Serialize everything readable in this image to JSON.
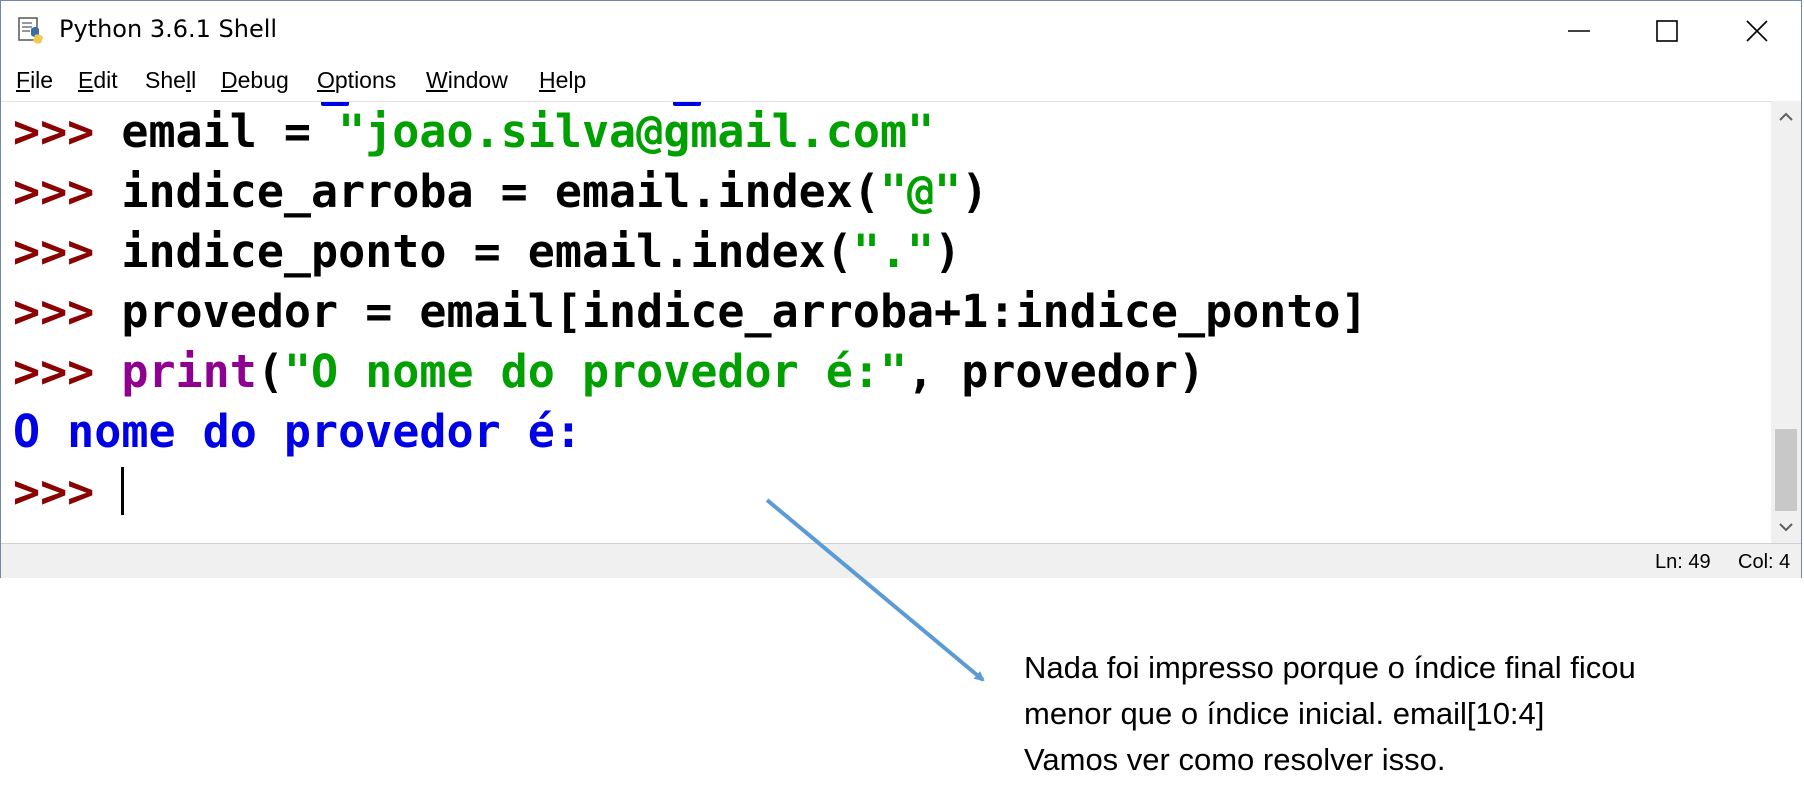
{
  "window": {
    "title": "Python 3.6.1 Shell",
    "controls": [
      "minimize",
      "maximize",
      "close"
    ]
  },
  "menu": [
    {
      "label": "File",
      "mnemonic": "F",
      "rest": "ile"
    },
    {
      "label": "Edit",
      "mnemonic": "E",
      "rest": "dit"
    },
    {
      "label": "Shell",
      "pre": "She",
      "mnemonic": "l",
      "rest": "l"
    },
    {
      "label": "Debug",
      "mnemonic": "D",
      "rest": "ebug"
    },
    {
      "label": "Options",
      "mnemonic": "O",
      "rest": "ptions"
    },
    {
      "label": "Window",
      "mnemonic": "W",
      "rest": "indow"
    },
    {
      "label": "Help",
      "mnemonic": "H",
      "rest": "elp"
    }
  ],
  "shell": {
    "prompt": ">>>",
    "lines": [
      {
        "kind": "input",
        "parts": [
          {
            "type": "ident",
            "text": "email = "
          },
          {
            "type": "str",
            "text": "\"joao.silva@gmail.com\""
          }
        ]
      },
      {
        "kind": "input",
        "parts": [
          {
            "type": "ident",
            "text": "indice_arroba = email.index("
          },
          {
            "type": "str",
            "text": "\"@\""
          },
          {
            "type": "ident",
            "text": ")"
          }
        ]
      },
      {
        "kind": "input",
        "parts": [
          {
            "type": "ident",
            "text": "indice_ponto = email.index("
          },
          {
            "type": "str",
            "text": "\".\""
          },
          {
            "type": "ident",
            "text": ")"
          }
        ]
      },
      {
        "kind": "input",
        "parts": [
          {
            "type": "ident",
            "text": "provedor = email[indice_arroba+1:indice_ponto]"
          }
        ]
      },
      {
        "kind": "input",
        "parts": [
          {
            "type": "builtin",
            "text": "print"
          },
          {
            "type": "ident",
            "text": "("
          },
          {
            "type": "str",
            "text": "\"O nome do provedor é:\""
          },
          {
            "type": "ident",
            "text": ", provedor)"
          }
        ]
      },
      {
        "kind": "output",
        "parts": [
          {
            "type": "out",
            "text": "O nome do provedor é:"
          }
        ]
      },
      {
        "kind": "input",
        "parts": [],
        "cursor": true
      }
    ]
  },
  "status": {
    "line": "Ln: 49",
    "col": "Col: 4"
  },
  "annotation": {
    "lines": [
      "Nada foi impresso porque o índice final ficou",
      "menor que o índice inicial. email[10:4]",
      "Vamos ver como resolver isso."
    ],
    "arrow_color": "#5b9bd5"
  },
  "colors": {
    "prompt": "#8b0000",
    "string": "#00a000",
    "builtin": "#900090",
    "output": "#0000e6"
  }
}
